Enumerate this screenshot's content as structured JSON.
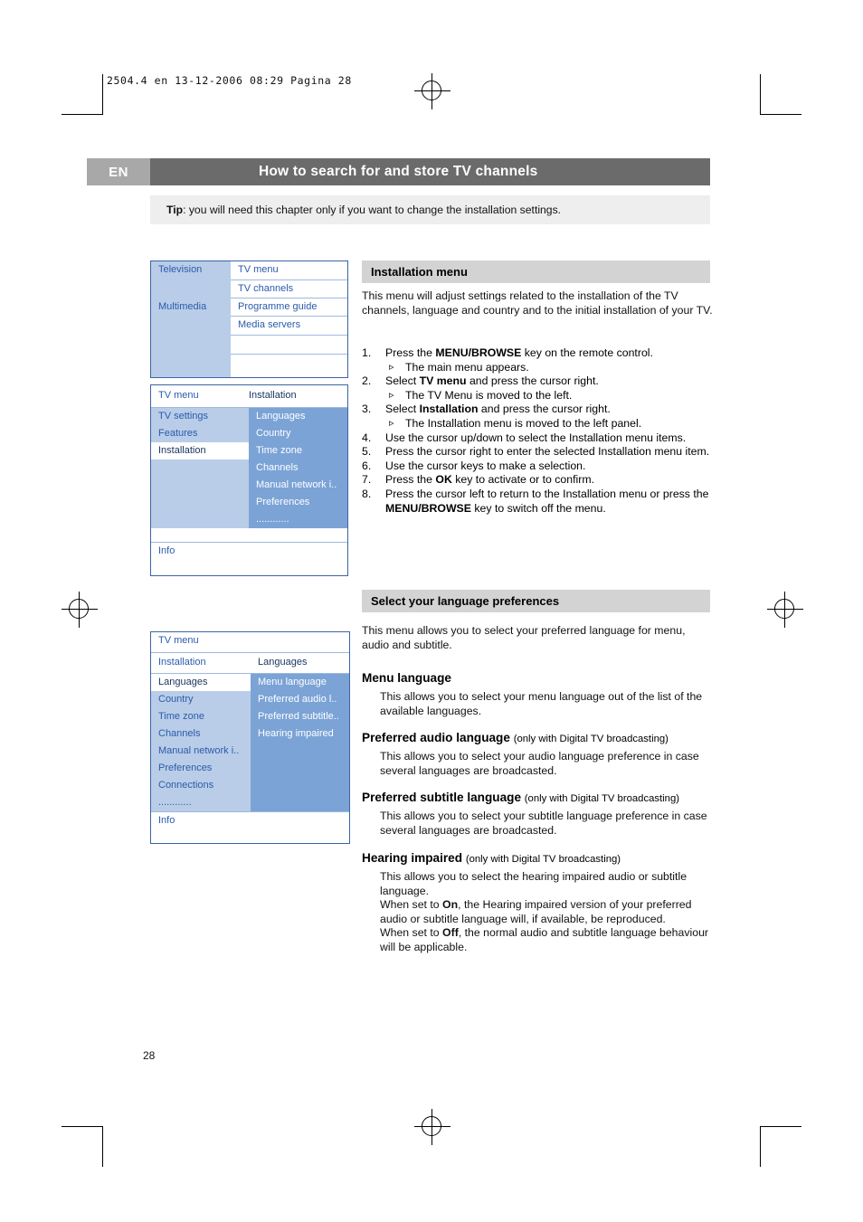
{
  "print_header": "2504.4 en   13-12-2006  08:29   Pagina 28",
  "page_number": "28",
  "header": {
    "lang_badge": "EN",
    "title": "How to search for and store TV channels",
    "tip_label": "Tip",
    "tip_text": ": you will need this chapter only if you want to change the installation settings."
  },
  "section1": {
    "heading": "Installation menu",
    "intro": "This menu will adjust settings related to the installation of the TV channels, language and country and to the initial installation of your TV.",
    "steps": [
      {
        "num": "1.",
        "text_pre": "Press the ",
        "bold": "MENU/BROWSE",
        "text_post": " key on the remote control.",
        "sub": "The main menu appears."
      },
      {
        "num": "2.",
        "text_pre": "Select ",
        "bold": "TV menu",
        "text_post": " and press the cursor right.",
        "sub": "The TV Menu is moved to the left."
      },
      {
        "num": "3.",
        "text_pre": "Select ",
        "bold": "Installation",
        "text_post": " and press the cursor right.",
        "sub": "The Installation menu is moved to the left panel."
      },
      {
        "num": "4.",
        "text_pre": "Use the cursor up/down to select the Installation menu items.",
        "bold": "",
        "text_post": "",
        "sub": ""
      },
      {
        "num": "5.",
        "text_pre": "Press the cursor right to enter the selected Installation menu item.",
        "bold": "",
        "text_post": "",
        "sub": ""
      },
      {
        "num": "6.",
        "text_pre": "Use the cursor keys to make a selection.",
        "bold": "",
        "text_post": "",
        "sub": ""
      },
      {
        "num": "7.",
        "text_pre": "Press the ",
        "bold": "OK",
        "text_post": " key to activate or to confirm.",
        "sub": ""
      },
      {
        "num": "8.",
        "text_pre": "Press the cursor left to return to the Installation menu or press the ",
        "bold": "MENU/BROWSE",
        "text_post": " key to switch off the menu.",
        "sub": ""
      }
    ]
  },
  "section2": {
    "heading": "Select your language preferences",
    "intro": "This menu allows you to select your preferred language for menu, audio and subtitle.",
    "blocks": [
      {
        "title": "Menu language",
        "qualifier": "",
        "body": "This allows you to select your menu language out of the list of the available languages."
      },
      {
        "title": "Preferred audio language",
        "qualifier": "(only with Digital TV broadcasting)",
        "body": "This allows you to select your audio language preference in case several languages are broadcasted."
      },
      {
        "title": "Preferred subtitle language",
        "qualifier": "(only with Digital TV broadcasting)",
        "body": "This allows you to select your subtitle language preference in case several languages are broadcasted."
      },
      {
        "title": "Hearing impaired",
        "qualifier": "(only with Digital TV broadcasting)",
        "body_lines": [
          "This allows you to select the hearing impaired audio or subtitle language.",
          "When set to On, the Hearing impaired version of your preferred audio or subtitle language will, if available, be reproduced.",
          "When set to Off, the normal audio and subtitle language behaviour will be applicable."
        ]
      }
    ]
  },
  "osd_panel1": {
    "left": [
      "Television",
      "",
      "Multimedia",
      "",
      ""
    ],
    "right": [
      "TV menu",
      "TV channels",
      "Programme guide",
      "Media servers",
      ""
    ]
  },
  "osd_panel2": {
    "title_left": "TV menu",
    "title_right": "Installation",
    "left": [
      "TV settings",
      "Features",
      "Installation",
      "",
      "",
      "",
      "",
      ""
    ],
    "right": [
      "Languages",
      "Country",
      "Time zone",
      "Channels",
      "Manual network i..",
      "Preferences",
      "............",
      ""
    ],
    "footer": "Info"
  },
  "osd_panel3": {
    "title": "TV menu",
    "second_left": "Installation",
    "second_right": "Languages",
    "left": [
      "Languages",
      "Country",
      "Time zone",
      "Channels",
      "Manual network i..",
      "Preferences",
      "Connections",
      "............"
    ],
    "right": [
      "Menu language",
      "Preferred audio l..",
      "Preferred subtitle..",
      "Hearing impaired",
      "",
      "",
      "",
      ""
    ],
    "footer": "Info"
  },
  "colors": {
    "title_bar": "#6b6b6b",
    "badge": "#a8a8a8",
    "section_head": "#d3d3d3",
    "osd_border": "#3c64a6",
    "osd_light": "#b9cde8",
    "osd_mid": "#7ba3d6",
    "osd_text": "#2a5bab"
  }
}
